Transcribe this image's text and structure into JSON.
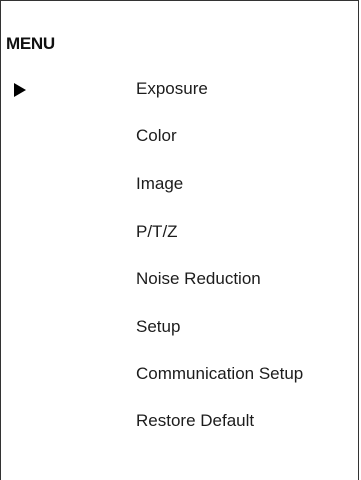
{
  "menu": {
    "title": "MENU",
    "selected_index": 0,
    "items": [
      {
        "label": "Exposure"
      },
      {
        "label": "Color"
      },
      {
        "label": "Image"
      },
      {
        "label": "P/T/Z"
      },
      {
        "label": "Noise Reduction"
      },
      {
        "label": "Setup"
      },
      {
        "label": "Communication Setup"
      },
      {
        "label": "Restore Default"
      }
    ]
  },
  "icons": {
    "cursor": "play-arrow-icon"
  },
  "colors": {
    "background": "#ffffff",
    "text": "#1c1c1c",
    "border": "#333333",
    "cursor": "#000000"
  }
}
